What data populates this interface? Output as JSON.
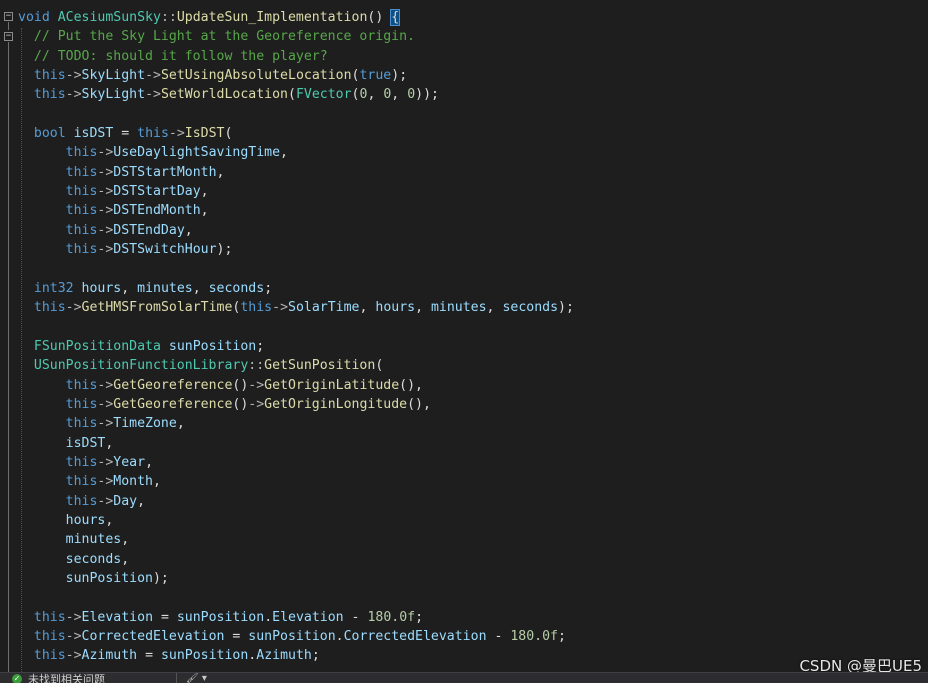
{
  "editor": {
    "lines": [
      [
        [
          "tx",
          ""
        ],
        [
          "kw",
          "void"
        ],
        [
          "tx",
          " "
        ],
        [
          "tp",
          "ACesiumSunSky"
        ],
        [
          "op",
          "::"
        ],
        [
          "fn",
          "UpdateSun_Implementation"
        ],
        [
          "tx",
          "() "
        ],
        [
          "brace",
          "{"
        ]
      ],
      [
        [
          "tx",
          "  "
        ],
        [
          "cm",
          "// Put the Sky Light at the Georeference origin."
        ]
      ],
      [
        [
          "tx",
          "  "
        ],
        [
          "cm",
          "// TODO: should it follow the player?"
        ]
      ],
      [
        [
          "tx",
          "  "
        ],
        [
          "kw",
          "this"
        ],
        [
          "op",
          "->"
        ],
        [
          "var",
          "SkyLight"
        ],
        [
          "op",
          "->"
        ],
        [
          "fn",
          "SetUsingAbsoluteLocation"
        ],
        [
          "tx",
          "("
        ],
        [
          "kw",
          "true"
        ],
        [
          "tx",
          ");"
        ]
      ],
      [
        [
          "tx",
          "  "
        ],
        [
          "kw",
          "this"
        ],
        [
          "op",
          "->"
        ],
        [
          "var",
          "SkyLight"
        ],
        [
          "op",
          "->"
        ],
        [
          "fn",
          "SetWorldLocation"
        ],
        [
          "tx",
          "("
        ],
        [
          "tp",
          "FVector"
        ],
        [
          "tx",
          "("
        ],
        [
          "num",
          "0"
        ],
        [
          "tx",
          ", "
        ],
        [
          "num",
          "0"
        ],
        [
          "tx",
          ", "
        ],
        [
          "num",
          "0"
        ],
        [
          "tx",
          "));"
        ]
      ],
      [
        [
          "tx",
          ""
        ]
      ],
      [
        [
          "tx",
          "  "
        ],
        [
          "kw",
          "bool"
        ],
        [
          "tx",
          " "
        ],
        [
          "var",
          "isDST"
        ],
        [
          "tx",
          " = "
        ],
        [
          "kw",
          "this"
        ],
        [
          "op",
          "->"
        ],
        [
          "fn",
          "IsDST"
        ],
        [
          "tx",
          "("
        ]
      ],
      [
        [
          "tx",
          "      "
        ],
        [
          "kw",
          "this"
        ],
        [
          "op",
          "->"
        ],
        [
          "var",
          "UseDaylightSavingTime"
        ],
        [
          "tx",
          ","
        ]
      ],
      [
        [
          "tx",
          "      "
        ],
        [
          "kw",
          "this"
        ],
        [
          "op",
          "->"
        ],
        [
          "var",
          "DSTStartMonth"
        ],
        [
          "tx",
          ","
        ]
      ],
      [
        [
          "tx",
          "      "
        ],
        [
          "kw",
          "this"
        ],
        [
          "op",
          "->"
        ],
        [
          "var",
          "DSTStartDay"
        ],
        [
          "tx",
          ","
        ]
      ],
      [
        [
          "tx",
          "      "
        ],
        [
          "kw",
          "this"
        ],
        [
          "op",
          "->"
        ],
        [
          "var",
          "DSTEndMonth"
        ],
        [
          "tx",
          ","
        ]
      ],
      [
        [
          "tx",
          "      "
        ],
        [
          "kw",
          "this"
        ],
        [
          "op",
          "->"
        ],
        [
          "var",
          "DSTEndDay"
        ],
        [
          "tx",
          ","
        ]
      ],
      [
        [
          "tx",
          "      "
        ],
        [
          "kw",
          "this"
        ],
        [
          "op",
          "->"
        ],
        [
          "var",
          "DSTSwitchHour"
        ],
        [
          "tx",
          ");"
        ]
      ],
      [
        [
          "tx",
          ""
        ]
      ],
      [
        [
          "tx",
          "  "
        ],
        [
          "kw",
          "int32"
        ],
        [
          "tx",
          " "
        ],
        [
          "var",
          "hours"
        ],
        [
          "tx",
          ", "
        ],
        [
          "var",
          "minutes"
        ],
        [
          "tx",
          ", "
        ],
        [
          "var",
          "seconds"
        ],
        [
          "tx",
          ";"
        ]
      ],
      [
        [
          "tx",
          "  "
        ],
        [
          "kw",
          "this"
        ],
        [
          "op",
          "->"
        ],
        [
          "fn",
          "GetHMSFromSolarTime"
        ],
        [
          "tx",
          "("
        ],
        [
          "kw",
          "this"
        ],
        [
          "op",
          "->"
        ],
        [
          "var",
          "SolarTime"
        ],
        [
          "tx",
          ", "
        ],
        [
          "var",
          "hours"
        ],
        [
          "tx",
          ", "
        ],
        [
          "var",
          "minutes"
        ],
        [
          "tx",
          ", "
        ],
        [
          "var",
          "seconds"
        ],
        [
          "tx",
          ");"
        ]
      ],
      [
        [
          "tx",
          ""
        ]
      ],
      [
        [
          "tx",
          "  "
        ],
        [
          "tp",
          "FSunPositionData"
        ],
        [
          "tx",
          " "
        ],
        [
          "var",
          "sunPosition"
        ],
        [
          "tx",
          ";"
        ]
      ],
      [
        [
          "tx",
          "  "
        ],
        [
          "tp",
          "USunPositionFunctionLibrary"
        ],
        [
          "op",
          "::"
        ],
        [
          "fn",
          "GetSunPosition"
        ],
        [
          "tx",
          "("
        ]
      ],
      [
        [
          "tx",
          "      "
        ],
        [
          "kw",
          "this"
        ],
        [
          "op",
          "->"
        ],
        [
          "fn",
          "GetGeoreference"
        ],
        [
          "tx",
          "()"
        ],
        [
          "op",
          "->"
        ],
        [
          "fn",
          "GetOriginLatitude"
        ],
        [
          "tx",
          "(),"
        ]
      ],
      [
        [
          "tx",
          "      "
        ],
        [
          "kw",
          "this"
        ],
        [
          "op",
          "->"
        ],
        [
          "fn",
          "GetGeoreference"
        ],
        [
          "tx",
          "()"
        ],
        [
          "op",
          "->"
        ],
        [
          "fn",
          "GetOriginLongitude"
        ],
        [
          "tx",
          "(),"
        ]
      ],
      [
        [
          "tx",
          "      "
        ],
        [
          "kw",
          "this"
        ],
        [
          "op",
          "->"
        ],
        [
          "var",
          "TimeZone"
        ],
        [
          "tx",
          ","
        ]
      ],
      [
        [
          "tx",
          "      "
        ],
        [
          "var",
          "isDST"
        ],
        [
          "tx",
          ","
        ]
      ],
      [
        [
          "tx",
          "      "
        ],
        [
          "kw",
          "this"
        ],
        [
          "op",
          "->"
        ],
        [
          "var",
          "Year"
        ],
        [
          "tx",
          ","
        ]
      ],
      [
        [
          "tx",
          "      "
        ],
        [
          "kw",
          "this"
        ],
        [
          "op",
          "->"
        ],
        [
          "var",
          "Month"
        ],
        [
          "tx",
          ","
        ]
      ],
      [
        [
          "tx",
          "      "
        ],
        [
          "kw",
          "this"
        ],
        [
          "op",
          "->"
        ],
        [
          "var",
          "Day"
        ],
        [
          "tx",
          ","
        ]
      ],
      [
        [
          "tx",
          "      "
        ],
        [
          "var",
          "hours"
        ],
        [
          "tx",
          ","
        ]
      ],
      [
        [
          "tx",
          "      "
        ],
        [
          "var",
          "minutes"
        ],
        [
          "tx",
          ","
        ]
      ],
      [
        [
          "tx",
          "      "
        ],
        [
          "var",
          "seconds"
        ],
        [
          "tx",
          ","
        ]
      ],
      [
        [
          "tx",
          "      "
        ],
        [
          "var",
          "sunPosition"
        ],
        [
          "tx",
          ");"
        ]
      ],
      [
        [
          "tx",
          ""
        ]
      ],
      [
        [
          "tx",
          "  "
        ],
        [
          "kw",
          "this"
        ],
        [
          "op",
          "->"
        ],
        [
          "var",
          "Elevation"
        ],
        [
          "tx",
          " = "
        ],
        [
          "var",
          "sunPosition"
        ],
        [
          "tx",
          "."
        ],
        [
          "var",
          "Elevation"
        ],
        [
          "tx",
          " - "
        ],
        [
          "num",
          "180.0f"
        ],
        [
          "tx",
          ";"
        ]
      ],
      [
        [
          "tx",
          "  "
        ],
        [
          "kw",
          "this"
        ],
        [
          "op",
          "->"
        ],
        [
          "var",
          "CorrectedElevation"
        ],
        [
          "tx",
          " = "
        ],
        [
          "var",
          "sunPosition"
        ],
        [
          "tx",
          "."
        ],
        [
          "var",
          "CorrectedElevation"
        ],
        [
          "tx",
          " - "
        ],
        [
          "num",
          "180.0f"
        ],
        [
          "tx",
          ";"
        ]
      ],
      [
        [
          "tx",
          "  "
        ],
        [
          "kw",
          "this"
        ],
        [
          "op",
          "->"
        ],
        [
          "var",
          "Azimuth"
        ],
        [
          "tx",
          " = "
        ],
        [
          "var",
          "sunPosition"
        ],
        [
          "tx",
          "."
        ],
        [
          "var",
          "Azimuth"
        ],
        [
          "tx",
          ";"
        ]
      ]
    ]
  },
  "gutter": {
    "fold_symbol": "−"
  },
  "watermark": "CSDN @曼巴UE5",
  "statusbar": {
    "ok_icon_glyph": "✓",
    "message": "未找到相关问题",
    "tool_glyph": "🖌 ▾"
  },
  "colors": {
    "background": "#1e1e1e",
    "keyword": "#569cd6",
    "type": "#4ec9b0",
    "function": "#dcdcaa",
    "variable": "#9cdcfe",
    "comment": "#57a64a",
    "number": "#b5cea8"
  }
}
